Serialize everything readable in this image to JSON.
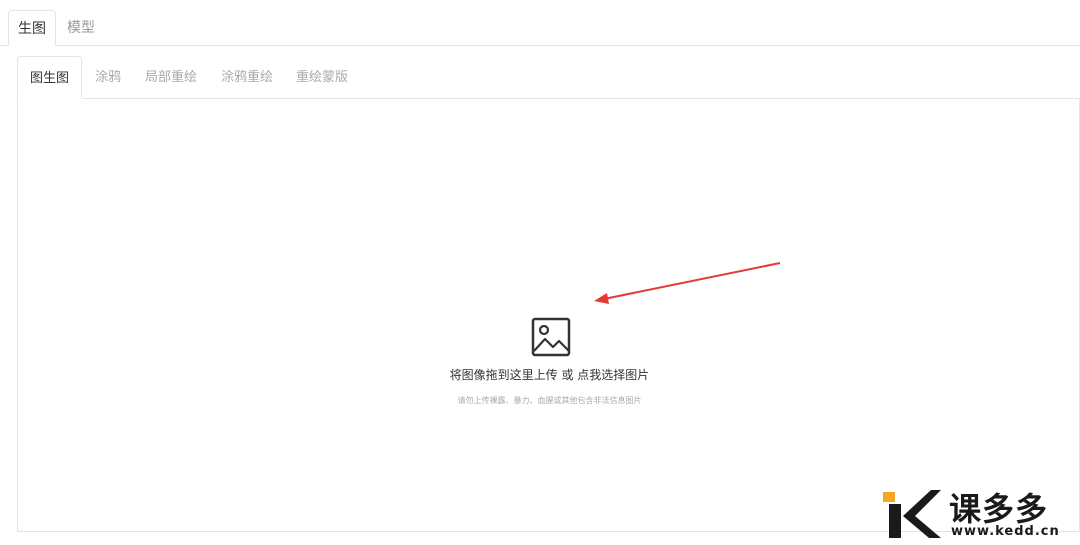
{
  "top_tabs": [
    {
      "label": "生图",
      "active": true
    },
    {
      "label": "模型",
      "active": false
    }
  ],
  "sub_tabs": [
    {
      "label": "图生图",
      "active": true
    },
    {
      "label": "涂鸦",
      "active": false
    },
    {
      "label": "局部重绘",
      "active": false
    },
    {
      "label": "涂鸦重绘",
      "active": false
    },
    {
      "label": "重绘蒙版",
      "active": false
    }
  ],
  "upload": {
    "main_text": "将图像拖到这里上传 或 点我选择图片",
    "note_text": "请勿上传裸露、暴力、血腥或其他包含非法信息图片",
    "icon": "image-icon"
  },
  "watermark": {
    "brand": "课多多",
    "url": "www.kedd.cn",
    "accent_color": "#f5a623"
  },
  "annotation": {
    "arrow_color": "#e53935"
  }
}
